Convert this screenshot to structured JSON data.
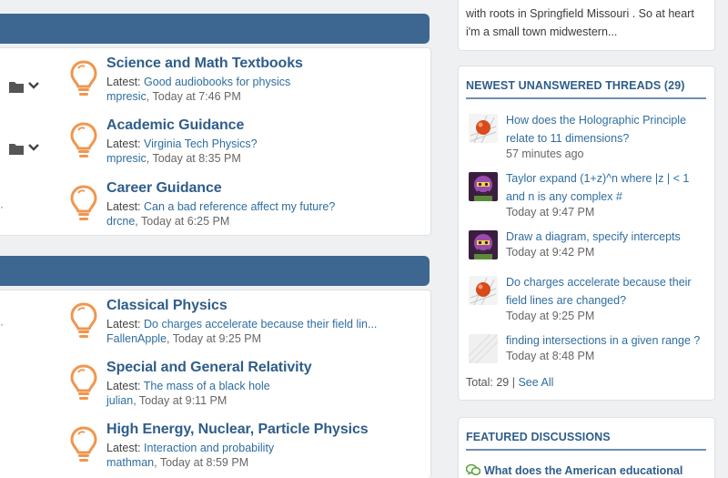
{
  "sections": [
    {
      "nodes": [
        {
          "title": "Science and Math Textbooks",
          "latest_label": "Latest:",
          "latest_thread": "Good audiobooks for physics",
          "user": "mpresic",
          "time": ", Today at 7:46 PM",
          "has_tools": true
        },
        {
          "title": "Academic Guidance",
          "latest_label": "Latest:",
          "latest_thread": "Virginia Tech Physics?",
          "user": "mpresic",
          "time": ", Today at 8:35 PM",
          "has_tools": true
        },
        {
          "title": "Career Guidance",
          "latest_label": "Latest:",
          "latest_thread": "Can a bad reference affect my future?",
          "user": "drcne",
          "time": ", Today at 6:25 PM",
          "has_tools": false
        }
      ]
    },
    {
      "nodes": [
        {
          "title": "Classical Physics",
          "latest_label": "Latest:",
          "latest_thread": "Do charges accelerate because their field lin...",
          "user": "FallenApple",
          "time": ", Today at 9:25 PM"
        },
        {
          "title": "Special and General Relativity",
          "latest_label": "Latest:",
          "latest_thread": "The mass of a black hole",
          "user": "julian",
          "time": ", Today at 9:11 PM"
        },
        {
          "title": "High Energy, Nuclear, Particle Physics",
          "latest_label": "Latest:",
          "latest_thread": "Interaction and probability",
          "user": "mathman",
          "time": ", Today at 8:59 PM"
        }
      ]
    }
  ],
  "sidebar": {
    "about_text": "with roots in Springfield Missouri . So at heart i'm a small town midwestern...",
    "unanswered": {
      "heading": "NEWEST UNANSWERED THREADS (29)",
      "threads": [
        {
          "title": "How does the Holographic Principle relate to 11 dimensions?",
          "time": "57 minutes ago",
          "avatar": "orange-ball-avatar"
        },
        {
          "title": "Taylor expand (1+z)^n where |z | < 1 and n is any complex #",
          "time": "Today at 9:47 PM",
          "avatar": "purple-face-avatar"
        },
        {
          "title": "Draw a diagram, specify intercepts",
          "time": "Today at 9:42 PM",
          "avatar": "purple-face-avatar"
        },
        {
          "title": "Do charges accelerate because their field lines are changed?",
          "time": "Today at 9:25 PM",
          "avatar": "orange-ball-avatar"
        },
        {
          "title": "finding intersections in a given range ?",
          "time": "Today at 8:48 PM",
          "avatar": "blank-avatar"
        }
      ],
      "total_label": "Total: 29",
      "separator": " | ",
      "see_all": "See All"
    },
    "featured": {
      "heading": "FEATURED DISCUSSIONS",
      "first_item": "What does the American educational"
    }
  },
  "colors": {
    "header_blue": "#3d6791",
    "link_blue": "#2f6da0",
    "bulb_orange": "#f0964f"
  }
}
